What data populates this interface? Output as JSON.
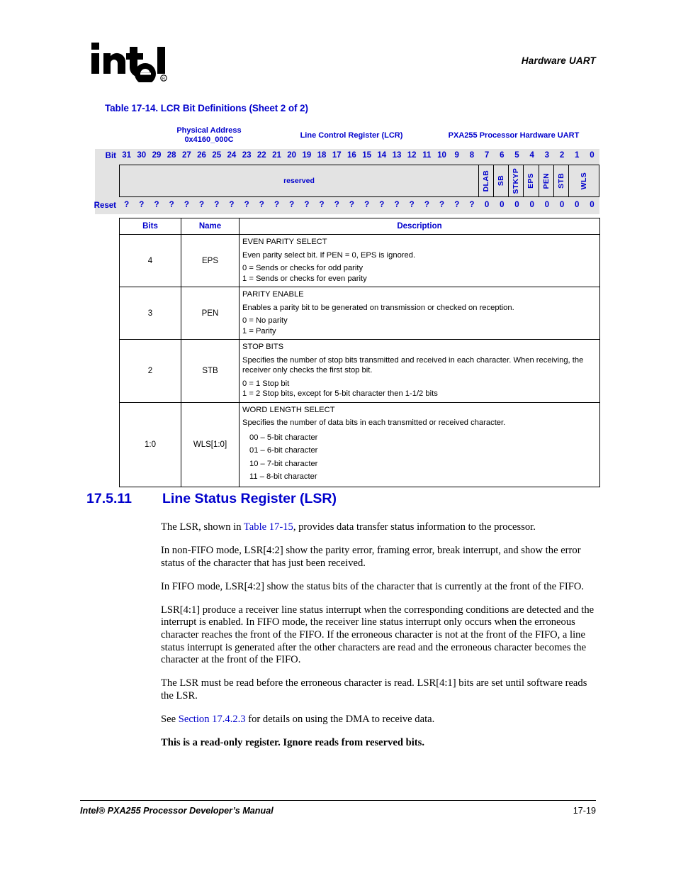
{
  "header": {
    "logo_alt": "intel",
    "logo_registered_mark": "®",
    "running_title": "Hardware UART"
  },
  "table_caption": "Table 17-14. LCR Bit Definitions (Sheet 2 of 2)",
  "register_diagram": {
    "physical_address_label": "Physical Address",
    "physical_address_value": "0x4160_000C",
    "register_name": "Line Control Register (LCR)",
    "processor_block": "PXA255 Processor Hardware UART",
    "bit_row_label": "Bit",
    "reset_row_label": "Reset",
    "bit_numbers": [
      "31",
      "30",
      "29",
      "28",
      "27",
      "26",
      "25",
      "24",
      "23",
      "22",
      "21",
      "20",
      "19",
      "18",
      "17",
      "16",
      "15",
      "14",
      "13",
      "12",
      "11",
      "10",
      "9",
      "8",
      "7",
      "6",
      "5",
      "4",
      "3",
      "2",
      "1",
      "0"
    ],
    "reset_values": [
      "?",
      "?",
      "?",
      "?",
      "?",
      "?",
      "?",
      "?",
      "?",
      "?",
      "?",
      "?",
      "?",
      "?",
      "?",
      "?",
      "?",
      "?",
      "?",
      "?",
      "?",
      "?",
      "?",
      "?",
      "0",
      "0",
      "0",
      "0",
      "0",
      "0",
      "0",
      "0"
    ],
    "fields": [
      {
        "label": "reserved",
        "span": 24,
        "orientation": "horizontal"
      },
      {
        "label": "DLAB",
        "span": 1,
        "orientation": "vertical"
      },
      {
        "label": "SB",
        "span": 1,
        "orientation": "vertical"
      },
      {
        "label": "STKYP",
        "span": 1,
        "orientation": "vertical"
      },
      {
        "label": "EPS",
        "span": 1,
        "orientation": "vertical"
      },
      {
        "label": "PEN",
        "span": 1,
        "orientation": "vertical"
      },
      {
        "label": "STB",
        "span": 1,
        "orientation": "vertical"
      },
      {
        "label": "WLS",
        "span": 2,
        "orientation": "vertical"
      }
    ]
  },
  "description_table": {
    "columns": [
      "Bits",
      "Name",
      "Description"
    ],
    "rows": [
      {
        "bits": "4",
        "name": "EPS",
        "title": "EVEN PARITY SELECT",
        "body": "Even parity select bit. If PEN = 0, EPS is ignored.",
        "options": [
          "0 =  Sends or checks for odd parity",
          "1 =  Sends or checks for even parity"
        ],
        "options_indented": false
      },
      {
        "bits": "3",
        "name": "PEN",
        "title": "PARITY ENABLE",
        "body": "Enables a parity bit to be generated on transmission or checked on reception.",
        "options": [
          "0 =  No parity",
          "1 =  Parity"
        ],
        "options_indented": false
      },
      {
        "bits": "2",
        "name": "STB",
        "title": "STOP BITS",
        "body": "Specifies the number of stop bits transmitted and received in each character. When receiving, the receiver only checks the first stop bit.",
        "options": [
          "0 =  1 Stop bit",
          "1 =  2 Stop bits, except for 5-bit character then 1-1/2 bits"
        ],
        "options_indented": false
      },
      {
        "bits": "1:0",
        "name": "WLS[1:0]",
        "title": "WORD LENGTH SELECT",
        "body": "Specifies the number of data bits in each transmitted or received character.",
        "options": [
          "00 – 5-bit character",
          "01 – 6-bit character",
          "10 – 7-bit character",
          "11 – 8-bit character"
        ],
        "options_indented": true
      }
    ]
  },
  "section": {
    "number": "17.5.11",
    "title": "Line Status Register (LSR)",
    "paragraphs": [
      {
        "segments": [
          {
            "text": "The LSR, shown in ",
            "link": false
          },
          {
            "text": "Table 17-15",
            "link": true
          },
          {
            "text": ", provides data transfer status information to the processor.",
            "link": false
          }
        ],
        "bold": false
      },
      {
        "segments": [
          {
            "text": "In non-FIFO mode, LSR[4:2] show the parity error, framing error, break interrupt, and show the error status of the character that has just been received.",
            "link": false
          }
        ],
        "bold": false
      },
      {
        "segments": [
          {
            "text": "In FIFO mode, LSR[4:2] show the status bits of the character that is currently at the front of the FIFO.",
            "link": false
          }
        ],
        "bold": false
      },
      {
        "segments": [
          {
            "text": "LSR[4:1] produce a receiver line status interrupt when the corresponding conditions are detected and the interrupt is enabled. In FIFO mode, the receiver line status interrupt only occurs when the erroneous character reaches the front of the FIFO. If the erroneous character is not at the front of the FIFO, a line status interrupt is generated after the other characters are read and the erroneous character becomes the character at the front of the FIFO.",
            "link": false
          }
        ],
        "bold": false
      },
      {
        "segments": [
          {
            "text": "The LSR must be read before the erroneous character is read. LSR[4:1] bits are set until software reads the LSR.",
            "link": false
          }
        ],
        "bold": false
      },
      {
        "segments": [
          {
            "text": "See ",
            "link": false
          },
          {
            "text": "Section 17.4.2.3",
            "link": true
          },
          {
            "text": " for details on using the DMA to receive data.",
            "link": false
          }
        ],
        "bold": false
      },
      {
        "segments": [
          {
            "text": "This is a read-only register. Ignore reads from reserved bits.",
            "link": false
          }
        ],
        "bold": true
      }
    ]
  },
  "footer": {
    "manual_title": "Intel® PXA255 Processor Developer’s Manual",
    "page_number": "17-19"
  },
  "colors": {
    "heading_blue": "#0000CC",
    "link_blue": "#0000CC",
    "register_shade": "#E3E3E3",
    "text_black": "#000000"
  }
}
